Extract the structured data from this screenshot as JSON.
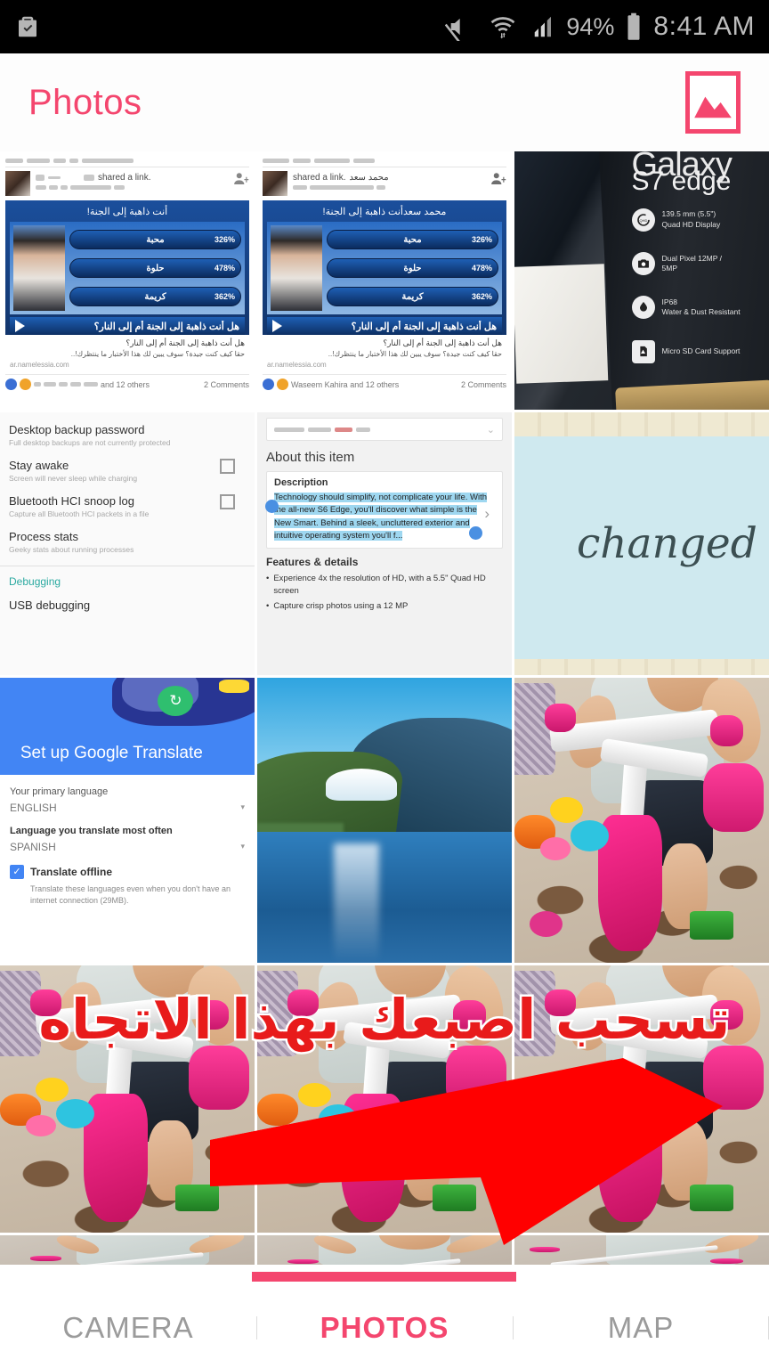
{
  "status_bar": {
    "icons": [
      "work-profile-icon",
      "mute-icon",
      "wifi-icon",
      "signal-icon"
    ],
    "battery_percent": "94%",
    "time": "8:41 AM"
  },
  "header": {
    "title": "Photos",
    "action_icon": "gallery-icon",
    "accent_color": "#f4466e"
  },
  "overlay": {
    "instruction_arabic": "تسحب اصبعك بهذا الاتجاه",
    "instruction_text_color": "#e81b1b",
    "instruction_stroke_color": "#ffffff",
    "arrow_direction": "right",
    "arrow_color": "#ff0000"
  },
  "tabs": {
    "items": [
      {
        "label": "CAMERA",
        "active": false
      },
      {
        "label": "PHOTOS",
        "active": true
      },
      {
        "label": "MAP",
        "active": false
      }
    ],
    "active_color": "#f4466e",
    "inactive_color": "#9b9b9b"
  },
  "grid": {
    "columns": 3,
    "thumbnails": [
      {
        "kind": "screenshot-facebook-post",
        "name": "",
        "share_text": "shared a link.",
        "quiz_title": "أنت ذاهبة إلى الجنة!",
        "bars": [
          {
            "label": "محبة",
            "value": "326%"
          },
          {
            "label": "حلوة",
            "value": "478%"
          },
          {
            "label": "كريمة",
            "value": "362%"
          }
        ],
        "cta": "هل أنت ذاهبة إلى الجنة أم إلى النار؟",
        "desc_line1": "هل أنت ذاهبة إلى الجنة أم إلى النار؟",
        "desc_line2": "حقا كيف كنت جيدة؟ سوف يبين لك هذا الأختبار ما ينتظرك!..",
        "domain": "ar.namelessia.com",
        "reactions": "and 12 others",
        "comments": "2 Comments"
      },
      {
        "kind": "screenshot-facebook-post",
        "name": "محمد سعد",
        "share_text": "shared a link.",
        "quiz_title": "محمد سعدأنت ذاهبة إلى الجنة!",
        "bars": [
          {
            "label": "محبة",
            "value": "326%"
          },
          {
            "label": "حلوة",
            "value": "478%"
          },
          {
            "label": "كريمة",
            "value": "362%"
          }
        ],
        "cta": "هل أنت ذاهبة إلى الجنة أم إلى النار؟",
        "desc_line1": "هل أنت ذاهبة إلى الجنة أم إلى النار؟",
        "desc_line2": "حقا كيف كنت جيدة؟ سوف يبين لك هذا الأختبار ما ينتظرك!..",
        "domain": "ar.namelessia.com",
        "reactions": "Waseem Kahira and 12 others",
        "comments": "2 Comments"
      },
      {
        "kind": "photo-phone-box",
        "brand": "Galaxy",
        "model": "S7 edge",
        "specs": [
          {
            "icon": "display-icon",
            "line1": "139.5 mm (5.5\")",
            "line2": "Quad HD Display"
          },
          {
            "icon": "camera-icon",
            "line1": "Dual Pixel 12MP /",
            "line2": "5MP"
          },
          {
            "icon": "waterproof-icon",
            "line1": "IP68",
            "line2": "Water & Dust Resistant"
          },
          {
            "icon": "sdcard-icon",
            "line1": "Micro SD Card Support",
            "line2": ""
          }
        ]
      },
      {
        "kind": "screenshot-developer-options",
        "items": [
          {
            "title": "Desktop backup password",
            "subtitle": "Full desktop backups are not currently protected",
            "checkbox": false
          },
          {
            "title": "Stay awake",
            "subtitle": "Screen will never sleep while charging",
            "checkbox": true
          },
          {
            "title": "Bluetooth HCI snoop log",
            "subtitle": "Capture all Bluetooth HCI packets in a file",
            "checkbox": true
          },
          {
            "title": "Process stats",
            "subtitle": "Geeky stats about running processes",
            "checkbox": false
          }
        ],
        "section_header": "Debugging",
        "next_item": "USB debugging"
      },
      {
        "kind": "screenshot-product-details",
        "heading": "About this item",
        "description_label": "Description",
        "description": "Technology should simplify, not complicate your life. With the all-new S6 Edge, you'll discover what simple is the New Smart. Behind a sleek, uncluttered exterior and intuitive operating system you'll f...",
        "features_label": "Features & details",
        "features": [
          "Experience 4x the resolution of HD, with a 5.5\" Quad HD screen",
          "Capture crisp photos using a 12 MP"
        ]
      },
      {
        "kind": "photo-text-changed",
        "word": "changed",
        "background_color": "#cfe9ef"
      },
      {
        "kind": "screenshot-google-translate",
        "title": "Set up Google Translate",
        "primary_language_label": "Your primary language",
        "primary_language_value": "ENGLISH",
        "translate_often_label": "Language you translate most often",
        "translate_often_value": "SPANISH",
        "checkbox_label": "Translate offline",
        "checkbox_checked": true,
        "checkbox_note": "Translate these languages even when you don't have an internet connection (29MB)."
      },
      {
        "kind": "photo-mountain-lake",
        "description": "Mountain lake with snow peak reflection"
      },
      {
        "kind": "photo-baby-bike",
        "description": "Toddler standing behind a pink toy bike with toys on carpet"
      },
      {
        "kind": "photo-baby-bike",
        "description": "Toddler with pink toy bike"
      },
      {
        "kind": "photo-baby-bike",
        "description": "Toddler with pink toy bike"
      },
      {
        "kind": "photo-baby-bike",
        "description": "Toddler with pink toy bike"
      },
      {
        "kind": "photo-baby-bike-crop",
        "description": "Toddler reaching for bike handlebar"
      },
      {
        "kind": "photo-baby-bike-crop",
        "description": "Toddler looking down at bike"
      },
      {
        "kind": "photo-baby-bike-crop",
        "description": "Toddler holding bike frame"
      }
    ]
  }
}
